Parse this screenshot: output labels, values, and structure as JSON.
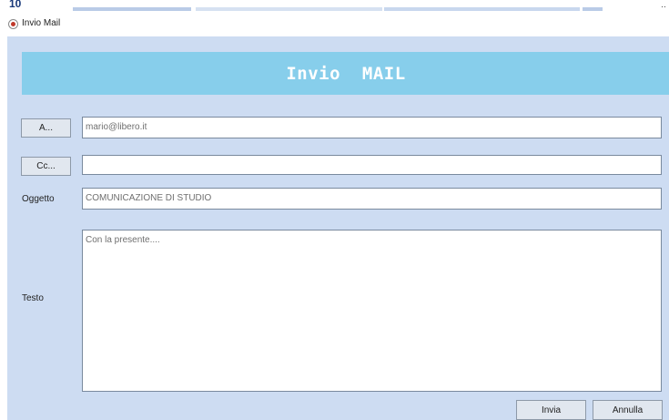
{
  "background_window": {
    "visible_number": "10"
  },
  "window": {
    "title": "Invio Mail"
  },
  "header": {
    "title": "Invio  MAIL"
  },
  "form": {
    "to_button_label": "A...",
    "to_value": "mario@libero.it",
    "cc_button_label": "Cc...",
    "cc_value": "",
    "subject_label": "Oggetto",
    "subject_value": "COMUNICAZIONE DI STUDIO",
    "body_label": "Testo",
    "body_value": "Con la presente...."
  },
  "actions": {
    "send_label": "Invia",
    "cancel_label": "Annulla"
  },
  "colors": {
    "window_background": "#cddcf2",
    "header_background": "#87ceeb",
    "header_text": "#ffffff"
  }
}
